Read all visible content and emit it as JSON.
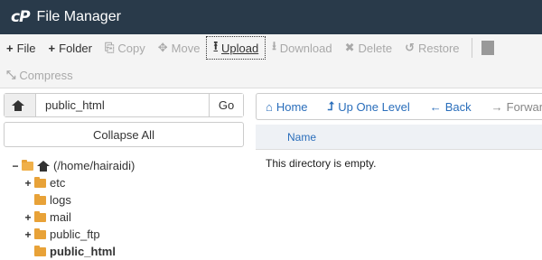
{
  "app": {
    "logo": "cP",
    "title": "File Manager"
  },
  "toolbar": {
    "row1": [
      {
        "id": "file",
        "label": "File",
        "icon": "plus-icon",
        "glyph": "+",
        "disabled": false
      },
      {
        "id": "folder",
        "label": "Folder",
        "icon": "plus-icon",
        "glyph": "+",
        "disabled": false
      },
      {
        "id": "copy",
        "label": "Copy",
        "icon": "copy-icon",
        "glyph": "⎘",
        "disabled": true
      },
      {
        "id": "move",
        "label": "Move",
        "icon": "move-icon",
        "glyph": "✥",
        "disabled": true
      },
      {
        "id": "upload",
        "label": "Upload",
        "icon": "upload-icon",
        "glyph": "⭱",
        "disabled": false
      },
      {
        "id": "download",
        "label": "Download",
        "icon": "download-icon",
        "glyph": "⭳",
        "disabled": true
      },
      {
        "id": "delete",
        "label": "Delete",
        "icon": "delete-icon",
        "glyph": "✖",
        "disabled": true
      },
      {
        "id": "restore",
        "label": "Restore",
        "icon": "restore-icon",
        "glyph": "↺",
        "disabled": true
      }
    ],
    "row2": [
      {
        "id": "compress",
        "label": "Compress",
        "icon": "compress-icon",
        "glyph": "⤡",
        "disabled": true
      }
    ]
  },
  "left": {
    "path_value": "public_html",
    "go_label": "Go",
    "collapse_label": "Collapse All",
    "tree_root": "(/home/hairaidi)",
    "tree": [
      {
        "label": "etc",
        "toggle": "+"
      },
      {
        "label": "logs",
        "toggle": ""
      },
      {
        "label": "mail",
        "toggle": "+"
      },
      {
        "label": "public_ftp",
        "toggle": "+"
      },
      {
        "label": "public_html",
        "toggle": "",
        "bold": true
      }
    ]
  },
  "right": {
    "nav": [
      {
        "id": "home",
        "label": "Home",
        "icon": "home-icon",
        "glyph": "⌂",
        "disabled": false
      },
      {
        "id": "up",
        "label": "Up One Level",
        "icon": "level-up-icon",
        "glyph": "⮥",
        "disabled": false
      },
      {
        "id": "back",
        "label": "Back",
        "icon": "back-arrow-icon",
        "glyph": "←",
        "disabled": false
      },
      {
        "id": "forward",
        "label": "Forward",
        "icon": "forward-arrow-icon",
        "glyph": "→",
        "disabled": true
      }
    ],
    "column_name": "Name",
    "empty_message": "This directory is empty."
  }
}
